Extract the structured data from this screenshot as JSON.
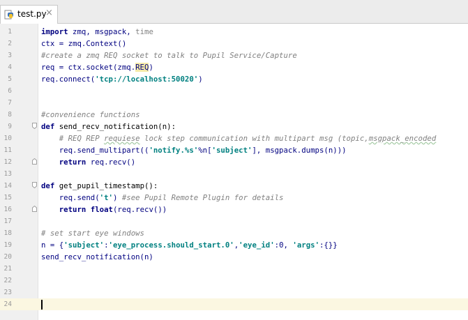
{
  "tab": {
    "filename": "test.py",
    "close": "×"
  },
  "editor": {
    "current_line": 24,
    "lines": [
      {
        "n": "1",
        "fold": "",
        "segs": [
          {
            "t": "import",
            "c": "kw"
          },
          {
            "t": " zmq, msgpack, ",
            "c": ""
          },
          {
            "t": "time",
            "c": "dim"
          }
        ]
      },
      {
        "n": "2",
        "fold": "",
        "segs": [
          {
            "t": "ctx = zmq.Context()",
            "c": ""
          }
        ]
      },
      {
        "n": "3",
        "fold": "",
        "segs": [
          {
            "t": "#create a zmq REQ socket to talk to Pupil Service/Capture",
            "c": "cmt"
          }
        ]
      },
      {
        "n": "4",
        "fold": "",
        "segs": [
          {
            "t": "req = ctx.socket(zmq.",
            "c": ""
          },
          {
            "t": "REQ",
            "c": "hl"
          },
          {
            "t": ")",
            "c": ""
          }
        ]
      },
      {
        "n": "5",
        "fold": "",
        "segs": [
          {
            "t": "req.connect(",
            "c": ""
          },
          {
            "t": "'tcp://localhost:50020'",
            "c": "str"
          },
          {
            "t": ")",
            "c": ""
          }
        ]
      },
      {
        "n": "6",
        "fold": "",
        "segs": []
      },
      {
        "n": "7",
        "fold": "",
        "segs": []
      },
      {
        "n": "8",
        "fold": "",
        "segs": [
          {
            "t": "#convenience functions",
            "c": "cmt"
          }
        ]
      },
      {
        "n": "9",
        "fold": "open",
        "segs": [
          {
            "t": "def",
            "c": "kw"
          },
          {
            "t": " send_recv_notification(n):",
            "c": "fn"
          }
        ]
      },
      {
        "n": "10",
        "fold": "",
        "segs": [
          {
            "t": "    # REQ REP ",
            "c": "cmt"
          },
          {
            "t": "requiese",
            "c": "cmt u"
          },
          {
            "t": " lock step communication with multipart msg (topic,",
            "c": "cmt"
          },
          {
            "t": "msgpack_encoded",
            "c": "cmt u"
          }
        ]
      },
      {
        "n": "11",
        "fold": "",
        "segs": [
          {
            "t": "    req.send_multipart((",
            "c": ""
          },
          {
            "t": "'notify.%s'",
            "c": "str"
          },
          {
            "t": "%n[",
            "c": ""
          },
          {
            "t": "'subject'",
            "c": "str"
          },
          {
            "t": "], msgpack.dumps(n)))",
            "c": ""
          }
        ]
      },
      {
        "n": "12",
        "fold": "end",
        "segs": [
          {
            "t": "    ",
            "c": ""
          },
          {
            "t": "return",
            "c": "kw"
          },
          {
            "t": " req.recv()",
            "c": ""
          }
        ]
      },
      {
        "n": "13",
        "fold": "",
        "segs": []
      },
      {
        "n": "14",
        "fold": "open",
        "segs": [
          {
            "t": "def",
            "c": "kw"
          },
          {
            "t": " get_pupil_timestamp():",
            "c": "fn"
          }
        ]
      },
      {
        "n": "15",
        "fold": "",
        "segs": [
          {
            "t": "    req.send(",
            "c": ""
          },
          {
            "t": "'t'",
            "c": "str"
          },
          {
            "t": ") ",
            "c": ""
          },
          {
            "t": "#see Pupil Remote Plugin for details",
            "c": "cmt"
          }
        ]
      },
      {
        "n": "16",
        "fold": "end",
        "segs": [
          {
            "t": "    ",
            "c": ""
          },
          {
            "t": "return",
            "c": "kw"
          },
          {
            "t": " ",
            "c": ""
          },
          {
            "t": "float",
            "c": "kw"
          },
          {
            "t": "(req.recv())",
            "c": ""
          }
        ]
      },
      {
        "n": "17",
        "fold": "",
        "segs": []
      },
      {
        "n": "18",
        "fold": "",
        "segs": [
          {
            "t": "# set start eye windows",
            "c": "cmt"
          }
        ]
      },
      {
        "n": "19",
        "fold": "",
        "segs": [
          {
            "t": "n = {",
            "c": ""
          },
          {
            "t": "'subject'",
            "c": "str"
          },
          {
            "t": ":",
            "c": ""
          },
          {
            "t": "'eye_process.should_start.0'",
            "c": "str"
          },
          {
            "t": ",",
            "c": ""
          },
          {
            "t": "'eye_id'",
            "c": "str"
          },
          {
            "t": ":0, ",
            "c": ""
          },
          {
            "t": "'args'",
            "c": "str"
          },
          {
            "t": ":{}}",
            "c": ""
          }
        ]
      },
      {
        "n": "20",
        "fold": "",
        "segs": [
          {
            "t": "send_recv_notification(n)",
            "c": ""
          }
        ]
      },
      {
        "n": "21",
        "fold": "",
        "segs": []
      },
      {
        "n": "22",
        "fold": "",
        "segs": []
      },
      {
        "n": "23",
        "fold": "",
        "segs": []
      },
      {
        "n": "24",
        "fold": "",
        "segs": []
      }
    ]
  }
}
